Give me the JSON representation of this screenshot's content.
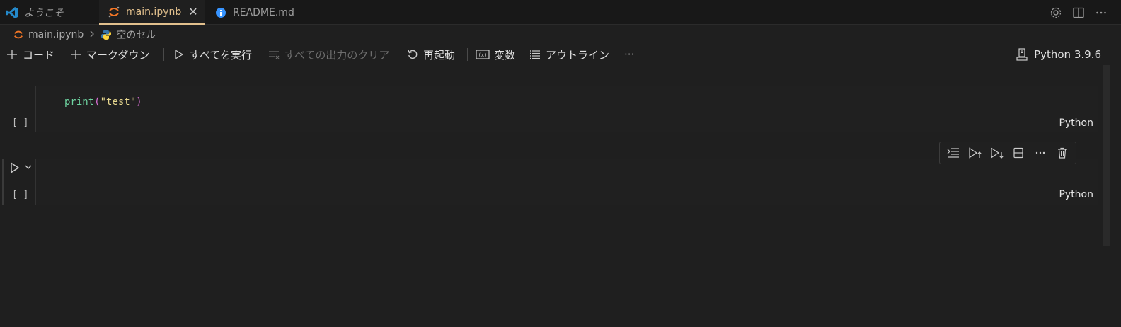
{
  "tabs": [
    {
      "label": "ようこそ",
      "icon": "vscode-logo-icon",
      "active": false
    },
    {
      "label": "main.ipynb",
      "icon": "jupyter-icon",
      "active": true,
      "close": "✕"
    },
    {
      "label": "README.md",
      "icon": "info-icon",
      "active": false
    }
  ],
  "breadcrumb": {
    "file": "main.ipynb",
    "section": "空のセル"
  },
  "toolbar": {
    "add_code": "コード",
    "add_markdown": "マークダウン",
    "run_all": "すべてを実行",
    "clear_outputs": "すべての出力のクリア",
    "restart": "再起動",
    "variables": "変数",
    "outline": "アウトライン",
    "more": "···"
  },
  "kernel": {
    "label": "Python 3.9.6"
  },
  "cells": [
    {
      "code": {
        "fn": "print",
        "open": "(",
        "str": "\"test\"",
        "close": ")"
      },
      "exec_count": "[ ]",
      "language": "Python"
    },
    {
      "code": null,
      "exec_count": "[ ]",
      "language": "Python"
    }
  ],
  "colors": {
    "active_tab": "#e2c08d",
    "background": "#1f1f1f",
    "python_blue": "#3776ab",
    "python_yellow": "#ffd43b",
    "jupyter_orange": "#f37626",
    "info_blue": "#3794ff",
    "vscode_blue": "#2489ca"
  }
}
